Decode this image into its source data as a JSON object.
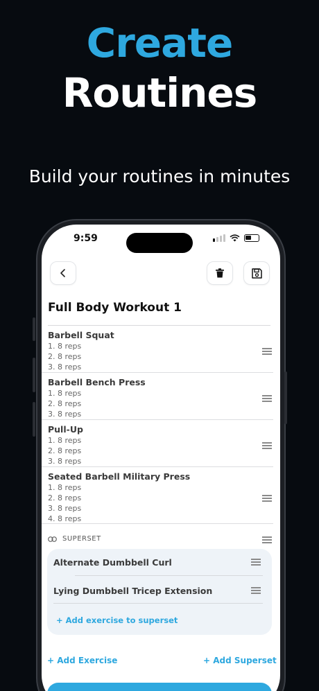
{
  "hero": {
    "line1": "Create",
    "line2": "Routines",
    "subtitle": "Build your routines in minutes"
  },
  "status_bar": {
    "time": "9:59"
  },
  "routine": {
    "title": "Full Body Workout 1",
    "exercises": [
      {
        "name": "Barbell Squat",
        "sets": [
          "1. 8 reps",
          "2. 8 reps",
          "3. 8 reps"
        ]
      },
      {
        "name": "Barbell Bench Press",
        "sets": [
          "1. 8 reps",
          "2. 8 reps",
          "3. 8 reps"
        ]
      },
      {
        "name": "Pull-Up",
        "sets": [
          "1. 8 reps",
          "2. 8 reps",
          "3. 8 reps"
        ]
      },
      {
        "name": "Seated Barbell Military Press",
        "sets": [
          "1. 8 reps",
          "2. 8 reps",
          "3. 8 reps",
          "4. 8 reps"
        ]
      }
    ],
    "superset": {
      "label": "SUPERSET",
      "items": [
        "Alternate Dumbbell Curl",
        "Lying Dumbbell Tricep Extension"
      ],
      "add_label": "+ Add exercise to superset"
    },
    "add_exercise_label": "+ Add Exercise",
    "add_superset_label": "+   Add Superset"
  },
  "icons": {
    "back": "chevron-left-icon",
    "delete": "trash-icon",
    "save": "save-icon",
    "drag": "drag-handle-icon",
    "link": "link-icon"
  },
  "colors": {
    "accent": "#2ea8df",
    "background": "#070b10"
  }
}
